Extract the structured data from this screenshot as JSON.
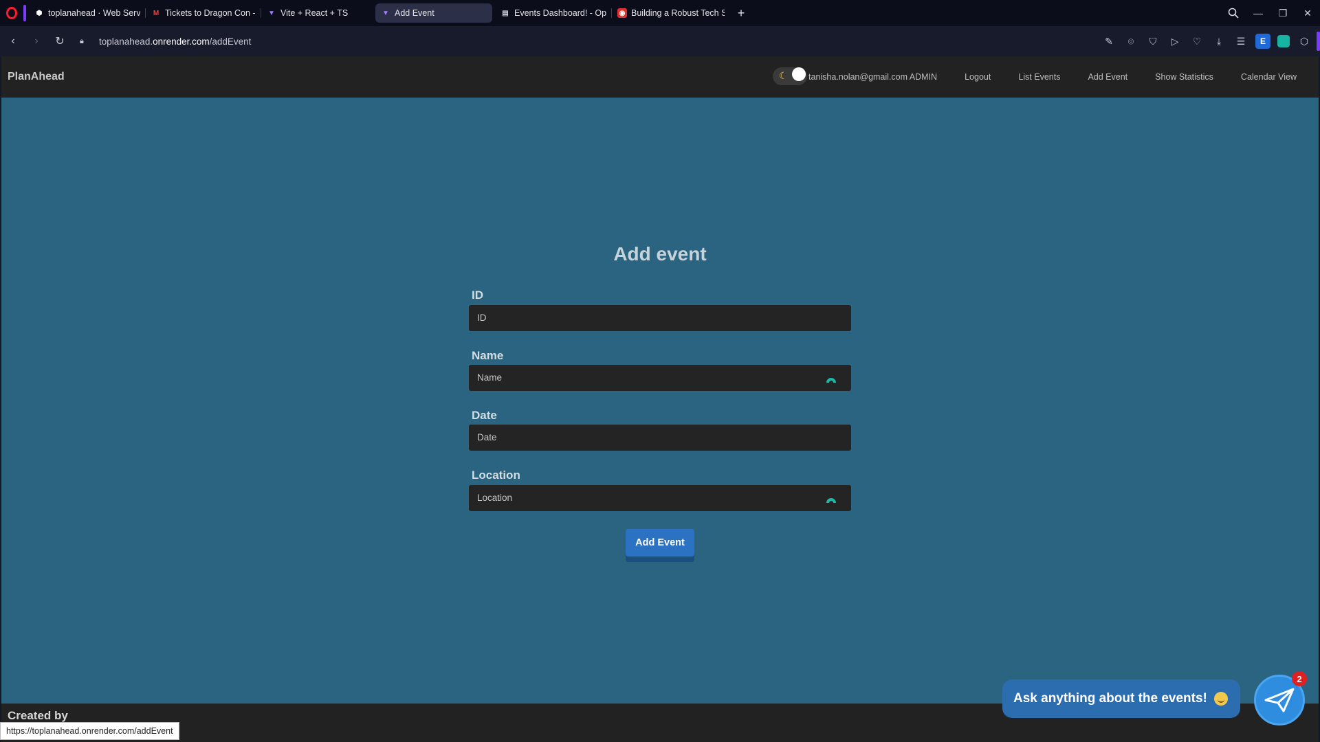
{
  "browser": {
    "tabs": [
      {
        "title": "toplanahead · Web Servic",
        "icon": "render-icon",
        "color": "#ffffff"
      },
      {
        "title": "Tickets to Dragon Con - h",
        "icon": "gmail-icon",
        "color": "#ea4335"
      },
      {
        "title": "Vite + React + TS",
        "icon": "vite-icon",
        "color": "#a47cff"
      },
      {
        "title": "Add Event",
        "icon": "vite-icon",
        "color": "#a47cff",
        "active": true
      },
      {
        "title": "Events Dashboard! - Oper",
        "icon": "page-icon",
        "color": "#cfd2e0"
      },
      {
        "title": "Building a Robust Tech Sta",
        "icon": "youtube-icon",
        "color": "#ff2d2d"
      }
    ],
    "url_prefix": "toplanahead.",
    "url_domain": "onrender.com",
    "url_path": "/addEvent",
    "extension_badge": "E",
    "status_url": "https://toplanahead.onrender.com/addEvent"
  },
  "app": {
    "brand": "PlanAhead",
    "user": "tanisha.nolan@gmail.com ADMIN",
    "nav": [
      "Logout",
      "List Events",
      "Add Event",
      "Show Statistics",
      "Calendar View"
    ],
    "form": {
      "title": "Add event",
      "fields": [
        {
          "label": "ID",
          "placeholder": "ID"
        },
        {
          "label": "Name",
          "placeholder": "Name"
        },
        {
          "label": "Date",
          "placeholder": "Date"
        },
        {
          "label": "Location",
          "placeholder": "Location"
        }
      ],
      "submit": "Add Event"
    },
    "footer": "Created by",
    "chat": {
      "prompt": "Ask anything about the events!",
      "badge": "2"
    }
  }
}
